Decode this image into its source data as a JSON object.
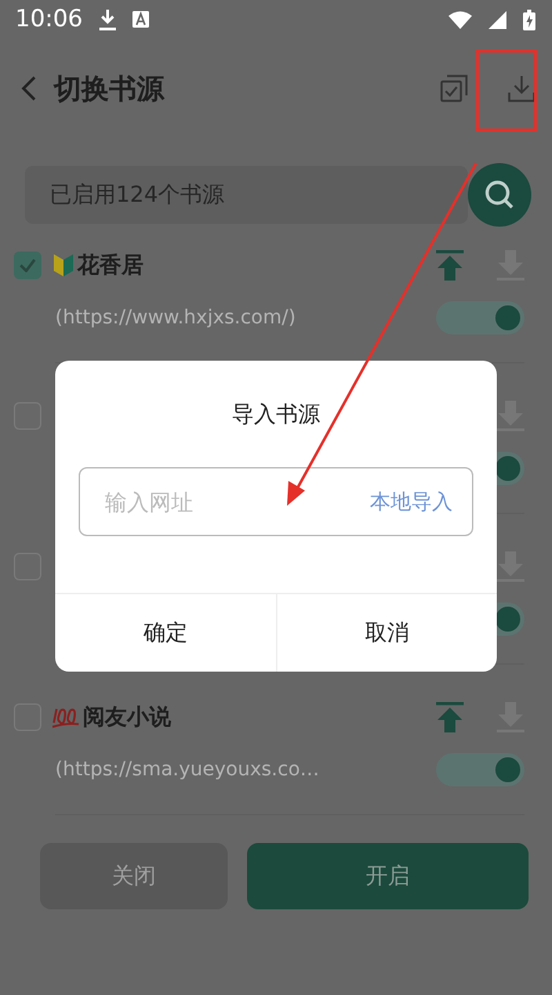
{
  "status_bar": {
    "time": "10:06"
  },
  "header": {
    "title": "切换书源"
  },
  "search": {
    "placeholder": "已启用124个书源"
  },
  "sources": [
    {
      "checked": true,
      "kind": "beginner",
      "name": "花香居",
      "url": "(https://www.hxjxs.com/)",
      "enabled": true
    },
    {
      "checked": false,
      "enabled": true
    },
    {
      "checked": false,
      "enabled": true
    },
    {
      "checked": false,
      "kind": "hundred",
      "name": "阅友小说",
      "url": "(https://sma.yueyouxs.co…",
      "enabled": true
    }
  ],
  "buttons": [
    {
      "label": "关闭",
      "kind": "secondary"
    },
    {
      "label": "开启",
      "kind": "primary"
    }
  ],
  "dialog": {
    "title": "导入书源",
    "field": {
      "placeholder": "输入网址"
    },
    "link": "本地导入",
    "buttons": [
      "确定",
      "取消"
    ]
  }
}
